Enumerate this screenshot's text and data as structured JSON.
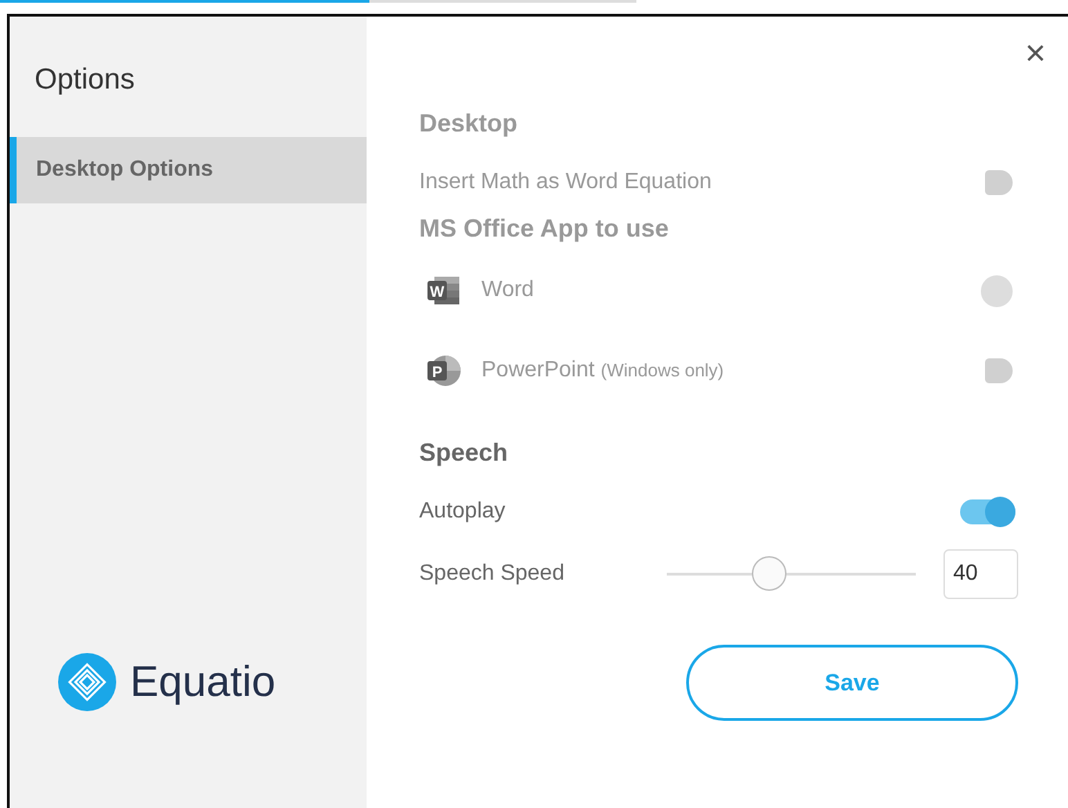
{
  "page_progress": {
    "level": 0.58
  },
  "sidebar": {
    "title": "Options",
    "items": [
      {
        "label": "Desktop Options",
        "selected": true
      }
    ],
    "logo": "Equatio"
  },
  "close": "×",
  "sections": [
    {
      "heading": "Desktop",
      "disabled": true,
      "rows": [
        {
          "kind": "toggle",
          "label": "Insert Math as Word Equation",
          "on": false,
          "disabled": true
        }
      ]
    },
    {
      "heading": "MS Office App to use",
      "disabled": true,
      "rows": [
        {
          "kind": "word",
          "letter": "W",
          "label": "Word",
          "on": false,
          "disabled": true
        },
        {
          "kind": "powerpoint",
          "letter": "P",
          "label": "PowerPoint",
          "note": "(Windows only)",
          "on": false,
          "disabled": true
        }
      ]
    },
    {
      "heading": "Speech",
      "disabled": false,
      "rows": [
        {
          "kind": "toggle",
          "label": "Autoplay",
          "on": true,
          "disabled": false
        },
        {
          "kind": "slider",
          "label": "Speech Speed",
          "level": 0.41,
          "value": "40"
        }
      ]
    }
  ],
  "save_button": "Save"
}
